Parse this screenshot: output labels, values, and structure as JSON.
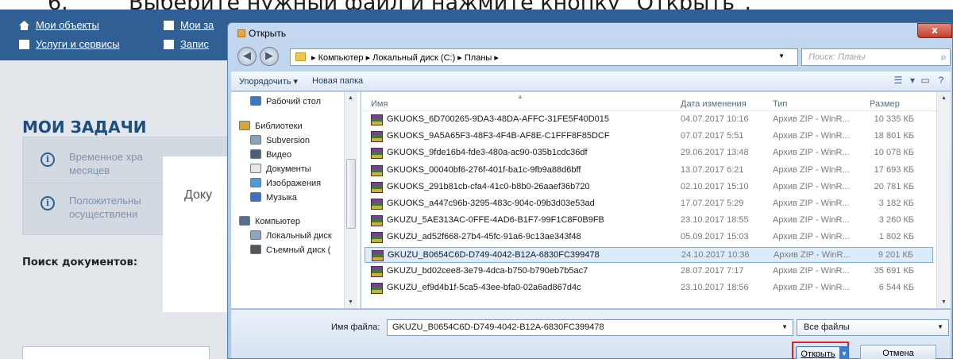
{
  "instruction": {
    "number": "6.",
    "text": "Выберите нужный файл и нажмите кнопку \"Открыть\"."
  },
  "background": {
    "nav_row1": [
      {
        "label": "Мои объекты",
        "icon": "home-icon"
      },
      {
        "label": "Мои за",
        "icon": "document-icon"
      }
    ],
    "nav_row2": [
      {
        "label": "Услуги и сервисы",
        "icon": "checkbox-icon"
      },
      {
        "label": "Запис",
        "icon": "checkbox-icon"
      }
    ],
    "title": "МОИ ЗАДАЧИ",
    "cards": [
      {
        "lines": [
          "Временное хра",
          "месяцев"
        ]
      },
      {
        "lines": [
          "Положительны",
          "осуществлени"
        ]
      }
    ],
    "search_label": "Поиск документов:",
    "modal_fragment": "Доку"
  },
  "dialog": {
    "title": "Открыть",
    "close": "x",
    "address": {
      "crumbs": "▸ Компьютер ▸ Локальный диск (C:) ▸ Планы ▸",
      "search_placeholder": "Поиск: Планы"
    },
    "toolbar": {
      "organize": "Упорядочить ▾",
      "new_folder": "Новая папка"
    },
    "nav_items": [
      {
        "label": "Рабочий стол",
        "icon": "desktop-icon",
        "sub": true
      },
      {
        "label": "Библиотеки",
        "icon": "libraries-icon",
        "sub": false
      },
      {
        "label": "Subversion",
        "icon": "subversion-icon",
        "sub": true
      },
      {
        "label": "Видео",
        "icon": "video-icon",
        "sub": true
      },
      {
        "label": "Документы",
        "icon": "documents-icon",
        "sub": true
      },
      {
        "label": "Изображения",
        "icon": "pictures-icon",
        "sub": true
      },
      {
        "label": "Музыка",
        "icon": "music-icon",
        "sub": true
      },
      {
        "label": "Компьютер",
        "icon": "computer-icon",
        "sub": false
      },
      {
        "label": "Локальный диск",
        "icon": "local-disk-icon",
        "sub": true
      },
      {
        "label": "Съемный диск (",
        "icon": "removable-disk-icon",
        "sub": true
      }
    ],
    "columns": {
      "name": "Имя",
      "date": "Дата изменения",
      "type": "Тип",
      "size": "Размер"
    },
    "files": [
      {
        "name": "GKUOKS_6D700265-9DA3-48DA-AFFC-31FE5F40D015",
        "date": "04.07.2017 10:16",
        "type": "Архив ZIP - WinR...",
        "size": "10 335 КБ"
      },
      {
        "name": "GKUOKS_9A5A65F3-48F3-4F4B-AF8E-C1FFF8F85DCF",
        "date": "07.07.2017 5:51",
        "type": "Архив ZIP - WinR...",
        "size": "18 801 КБ"
      },
      {
        "name": "GKUOKS_9fde16b4-fde3-480a-ac90-035b1cdc36df",
        "date": "29.06.2017 13:48",
        "type": "Архив ZIP - WinR...",
        "size": "10 078 КБ"
      },
      {
        "name": "GKUOKS_00040bf6-276f-401f-ba1c-9fb9a88d6bff",
        "date": "13.07.2017 6:21",
        "type": "Архив ZIP - WinR...",
        "size": "17 693 КБ"
      },
      {
        "name": "GKUOKS_291b81cb-cfa4-41c0-b8b0-26aaef36b720",
        "date": "02.10.2017 15:10",
        "type": "Архив ZIP - WinR...",
        "size": "20 781 КБ"
      },
      {
        "name": "GKUOKS_a447c96b-3295-483c-904c-09b3d03e53ad",
        "date": "17.07.2017 5:29",
        "type": "Архив ZIP - WinR...",
        "size": "3 182 КБ"
      },
      {
        "name": "GKUZU_5AE313AC-0FFE-4AD6-B1F7-99F1C8F0B9FB",
        "date": "23.10.2017 18:55",
        "type": "Архив ZIP - WinR...",
        "size": "3 260 КБ"
      },
      {
        "name": "GKUZU_ad52f668-27b4-45fc-91a6-9c13ae343f48",
        "date": "05.09.2017 15:03",
        "type": "Архив ZIP - WinR...",
        "size": "1 802 КБ"
      },
      {
        "name": "GKUZU_B0654C6D-D749-4042-B12A-6830FC399478",
        "date": "24.10.2017 10:36",
        "type": "Архив ZIP - WinR...",
        "size": "9 201 КБ",
        "selected": true
      },
      {
        "name": "GKUZU_bd02cee8-3e79-4dca-b750-b790eb7b5ac7",
        "date": "28.07.2017 7:17",
        "type": "Архив ZIP - WinR...",
        "size": "35 691 КБ"
      },
      {
        "name": "GKUZU_ef9d4b1f-5ca5-43ee-bfa0-02a6ad867d4c",
        "date": "23.10.2017 18:56",
        "type": "Архив ZIP - WinR...",
        "size": "6 544 КБ"
      }
    ],
    "filename_label": "Имя файла:",
    "filename_value": "GKUZU_B0654C6D-D749-4042-B12A-6830FC399478",
    "filter_value": "Все файлы",
    "open_label": "Открыть",
    "cancel_label": "Отмена",
    "highlight_color": "#e0202e",
    "selection_color": "#ddecfc"
  }
}
